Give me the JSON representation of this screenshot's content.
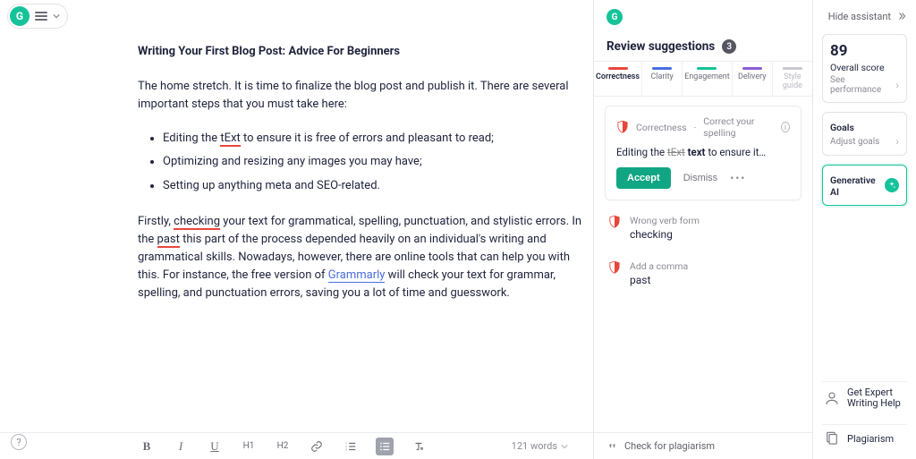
{
  "header": {
    "hide_assistant": "Hide assistant"
  },
  "document": {
    "title": "Writing Your First Blog Post: Advice For Beginners",
    "para1": "The home stretch. It is time to finalize the blog post and publish it. There are several important steps that you must take here:",
    "bullets": [
      {
        "pre": "Editing the ",
        "err": "tExt",
        "post": " to ensure it is free of errors and pleasant to read;"
      },
      {
        "pre": "Optimizing and resizing any images you may have;",
        "err": "",
        "post": ""
      },
      {
        "pre": "Setting up anything meta and SEO-related.",
        "err": "",
        "post": ""
      }
    ],
    "para2": {
      "p1": "Firstly, ",
      "err1": "checking",
      "p2": " your text for grammatical, spelling, punctuation, and stylistic errors. In the ",
      "err2": "past",
      "p3": " this part of the process depended heavily on an individual's writing and grammatical skills. Nowadays, however, there are online tools that can help you with this. For instance, the free version of ",
      "link": "Grammarly",
      "p4": " will check your text for grammar, spelling, and punctuation errors, saving you a lot of time and guesswork."
    }
  },
  "toolbar": {
    "b": "B",
    "i": "I",
    "u": "U",
    "h1": "H1",
    "h2": "H2",
    "word_count": "121 words"
  },
  "suggestions": {
    "title": "Review suggestions",
    "count": "3",
    "tabs": {
      "correctness": "Correctness",
      "clarity": "Clarity",
      "engagement": "Engagement",
      "delivery": "Delivery",
      "style": "Style guide"
    },
    "card1": {
      "category": "Correctness",
      "rule": "Correct your spelling",
      "sentence_pre": "Editing the ",
      "strike": "tExt",
      "bold": "text",
      "sentence_post": " to ensure it…",
      "accept": "Accept",
      "dismiss": "Dismiss"
    },
    "card2": {
      "label": "Wrong verb form",
      "value": "checking"
    },
    "card3": {
      "label": "Add a comma",
      "value": "past"
    },
    "footer": "Check for plagiarism"
  },
  "rail": {
    "score": "89",
    "score_label": "Overall score",
    "score_sub": "See performance",
    "goals_title": "Goals",
    "goals_sub": "Adjust goals",
    "gen_ai": "Generative AI",
    "expert_l1": "Get Expert",
    "expert_l2": "Writing Help",
    "plagiarism": "Plagiarism"
  }
}
